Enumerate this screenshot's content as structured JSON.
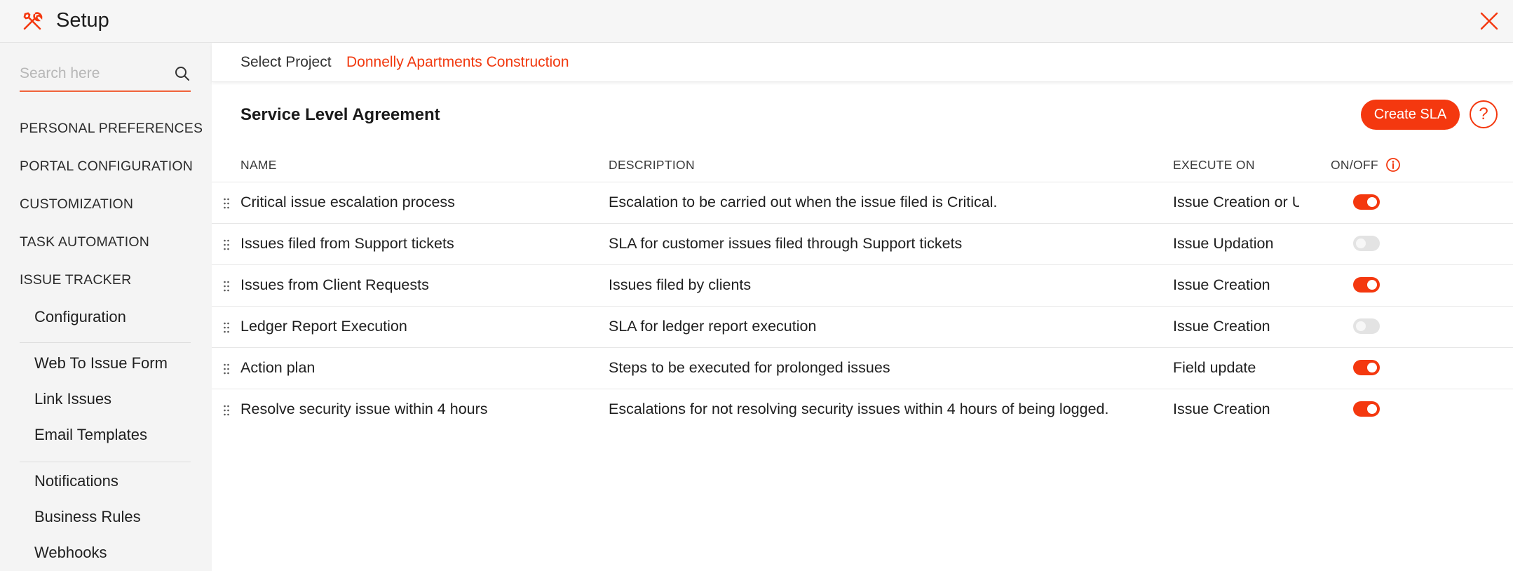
{
  "app": {
    "title": "Setup"
  },
  "colors": {
    "accent": "#f4380f",
    "toggle_off": "#e3e3e3",
    "sidebar_bg": "#f4f4f4"
  },
  "icons": {
    "app": "tools-icon",
    "close": "close-icon",
    "search": "search-icon",
    "help": "help-icon",
    "info": "info-icon",
    "drag": "drag-handle-icon"
  },
  "sidebar": {
    "search_placeholder": "Search here",
    "sections": [
      {
        "label": "PERSONAL PREFERENCES"
      },
      {
        "label": "PORTAL CONFIGURATION"
      },
      {
        "label": "CUSTOMIZATION"
      },
      {
        "label": "TASK AUTOMATION"
      },
      {
        "label": "ISSUE TRACKER"
      }
    ],
    "items": [
      {
        "label": "Configuration"
      },
      {
        "label": "Web To Issue Form"
      },
      {
        "label": "Link Issues"
      },
      {
        "label": "Email Templates"
      },
      {
        "label": "Notifications"
      },
      {
        "label": "Business Rules"
      },
      {
        "label": "Webhooks"
      }
    ]
  },
  "project": {
    "label": "Select Project",
    "value": "Donnelly Apartments Construction"
  },
  "main": {
    "title": "Service Level Agreement",
    "create_label": "Create SLA",
    "help_label": "?"
  },
  "table": {
    "columns": [
      "NAME",
      "DESCRIPTION",
      "EXECUTE ON",
      "ON/OFF"
    ],
    "rows": [
      {
        "name": "Critical issue escalation process",
        "description": "Escalation to be carried out when the issue filed is Critical.",
        "execute_on": "Issue Creation or Updation",
        "enabled": true
      },
      {
        "name": "Issues filed from Support tickets",
        "description": "SLA for customer issues filed through Support tickets",
        "execute_on": "Issue Updation",
        "enabled": false
      },
      {
        "name": "Issues from Client Requests",
        "description": "Issues filed by clients",
        "execute_on": "Issue Creation",
        "enabled": true
      },
      {
        "name": "Ledger Report Execution",
        "description": "SLA for ledger report execution",
        "execute_on": "Issue Creation",
        "enabled": false
      },
      {
        "name": "Action plan",
        "description": "Steps to be executed for prolonged issues",
        "execute_on": "Field update",
        "enabled": true
      },
      {
        "name": "Resolve security issue within 4 hours",
        "description": "Escalations for not resolving security issues within 4 hours of being logged.",
        "execute_on": "Issue Creation",
        "enabled": true
      }
    ]
  }
}
